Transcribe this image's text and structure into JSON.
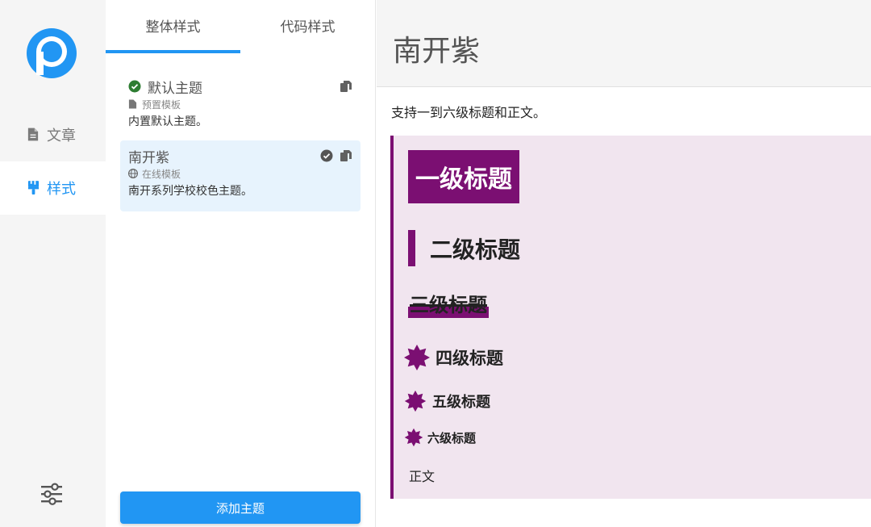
{
  "nav": {
    "items": [
      {
        "label": "文章",
        "icon": "file-icon"
      },
      {
        "label": "样式",
        "icon": "brush-icon"
      }
    ],
    "settings_icon": "sliders-icon"
  },
  "colors": {
    "accent": "#2196f3",
    "theme_purple": "#7b0f72",
    "sample_bg": "#f1e5ef",
    "success": "#2e7d32"
  },
  "tabs": [
    "整体样式",
    "代码样式"
  ],
  "themes": [
    {
      "name": "默认主题",
      "source": "预置模板",
      "description": "内置默认主题。",
      "status": "active-check"
    },
    {
      "name": "南开紫",
      "source": "在线模板",
      "description": "南开系列学校校色主题。",
      "status": "selected"
    }
  ],
  "add_button": "添加主题",
  "preview": {
    "title": "南开紫",
    "intro": "支持一到六级标题和正文。",
    "h1": "一级标题",
    "h2": "二级标题",
    "h3": "三级标题",
    "h4": "四级标题",
    "h5": "五级标题",
    "h6": "六级标题",
    "body": "正文"
  }
}
